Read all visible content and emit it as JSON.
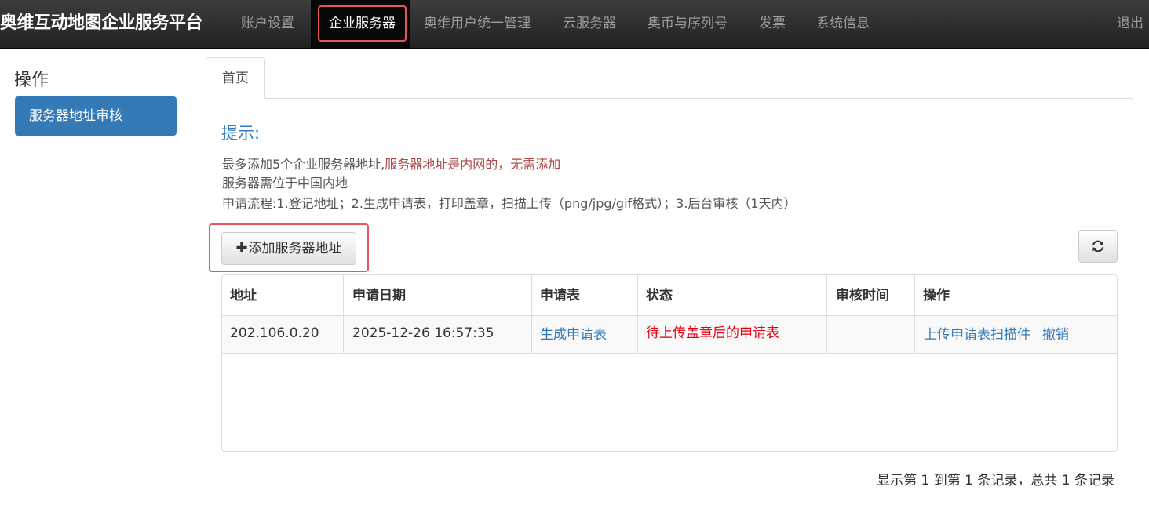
{
  "navbar": {
    "brand": "奥维互动地图企业服务平台",
    "items": [
      {
        "label": "账户设置"
      },
      {
        "label": "企业服务器"
      },
      {
        "label": "奥维用户统一管理"
      },
      {
        "label": "云服务器"
      },
      {
        "label": "奥币与序列号"
      },
      {
        "label": "发票"
      },
      {
        "label": "系统信息"
      }
    ],
    "logout": "退出"
  },
  "sidebar": {
    "heading": "操作",
    "items": [
      {
        "label": "服务器地址审核"
      }
    ]
  },
  "tabs": [
    {
      "label": "首页"
    }
  ],
  "tips": {
    "title": "提示:",
    "line1_a": "最多添加5个企业服务器地址,",
    "line1_b": "服务器地址是内网的，无需添加",
    "line2": "服务器需位于中国内地",
    "line3": "申请流程:1.登记地址；2.生成申请表，打印盖章，扫描上传（png/jpg/gif格式）；3.后台审核（1天内）"
  },
  "toolbar": {
    "add_label": "添加服务器地址",
    "add_icon": "plus-icon",
    "refresh_icon": "refresh-icon"
  },
  "table": {
    "headers": [
      "地址",
      "申请日期",
      "申请表",
      "状态",
      "审核时间",
      "操作"
    ],
    "rows": [
      {
        "address": "202.106.0.20",
        "date": "2025-12-26 16:57:35",
        "form": "生成申请表",
        "status": "待上传盖章后的申请表",
        "review_time": "",
        "action_upload": "上传申请表扫描件",
        "action_cancel": "撤销"
      }
    ]
  },
  "pagination": {
    "info": "显示第 1 到第 1 条记录，总共 1 条记录"
  },
  "colors": {
    "primary": "#337ab7",
    "status_red": "#e4000f",
    "highlight": "#e8555f",
    "navbar": "#222222"
  }
}
